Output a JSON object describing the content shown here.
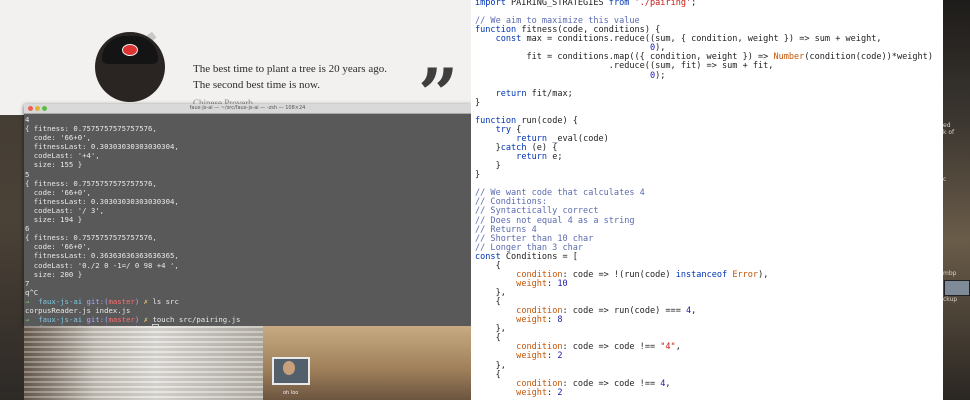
{
  "quote": {
    "line1": "The best time to plant a tree is 20 years ago.",
    "line2": "The second best time is now.",
    "author": "Chinese Proverb"
  },
  "terminal": {
    "title": "faux-js-ai — ~/src/faux-js-ai — -zsh — 108×24",
    "lines": [
      "4",
      "{ fitness: 0.7575757575757576,",
      "  code: '66+0',",
      "  fitnessLast: 0.30303030303030304,",
      "  codeLast: '+4',",
      "  size: 155 }",
      "5",
      "{ fitness: 0.7575757575757576,",
      "  code: '66+0',",
      "  fitnessLast: 0.30303030303030304,",
      "  codeLast: '/ 3',",
      "  size: 194 }",
      "6",
      "{ fitness: 0.7575757575757576,",
      "  code: '66+0',",
      "  fitnessLast: 0.36363636363636365,",
      "  codeLast: '0./2 0 -1=/ 0 98 +4 ',",
      "  size: 200 }",
      "7",
      "q^C"
    ],
    "prompt_dir": "faux-js-ai",
    "prompt_git": "git:(",
    "prompt_branch": "master",
    "prompt_git_close": ")",
    "prompt_x": "✗",
    "cmd1": "ls src",
    "ls_output": "corpusReader.js index.js",
    "cmd2": "touch src/pairing.js"
  },
  "editor": {
    "lines": [
      "import PAIRING_STRATEGIES from './pairing';",
      "",
      "// We aim to maximize this value",
      "function fitness(code, conditions) {",
      "    const max = conditions.reduce((sum, { condition, weight }) => sum + weight,",
      "                                  0),",
      "          fit = conditions.map(({ condition, weight }) => Number(condition(code))*weight)",
      "                          .reduce((sum, fit) => sum + fit,",
      "                                  0);",
      "",
      "    return fit/max;",
      "}",
      "",
      "function run(code) {",
      "    try {",
      "        return _eval(code)",
      "    }catch (e) {",
      "        return e;",
      "    }",
      "}",
      "",
      "// We want code that calculates 4",
      "// Conditions:",
      "// Syntactically correct",
      "// Does not equal 4 as a string",
      "// Returns 4",
      "// Shorter than 10 char",
      "// Longer than 3 char",
      "const Conditions = [",
      "    {",
      "        condition: code => !(run(code) instanceof Error),",
      "        weight: 10",
      "    },",
      "    {",
      "        condition: code => run(code) === 4,",
      "        weight: 8",
      "    },",
      "    {",
      "        condition: code => code !== \"4\",",
      "        weight: 2",
      "    },",
      "    {",
      "        condition: code => code !== 4,",
      "        weight: 2"
    ]
  },
  "sidebar": {
    "label1": "ed",
    "label2": "k of",
    "label3": "c",
    "label4": "mbp",
    "label5": "ckup"
  },
  "webcam": {
    "name_label": "oh loo"
  }
}
